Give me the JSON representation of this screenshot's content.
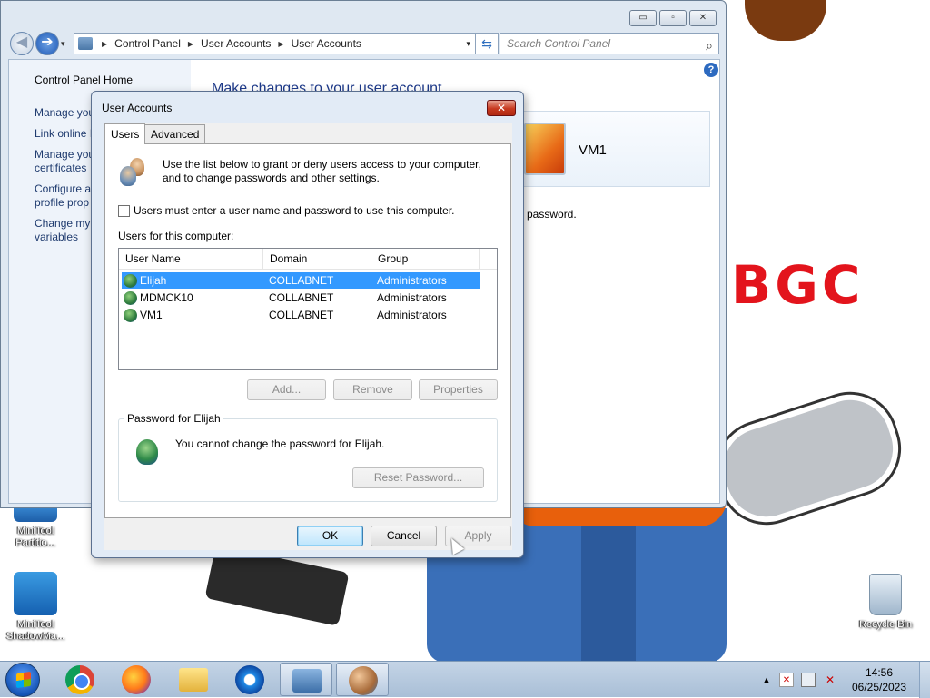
{
  "desktop": {
    "wallpaper_logo": "BGC",
    "icons": [
      {
        "label": "MiniTool Partitio..."
      },
      {
        "label": "MiniTool ShadowMa..."
      },
      {
        "label": "Recycle Bin"
      }
    ]
  },
  "control_panel": {
    "caption_buttons": {
      "minimize": "▭",
      "maximize": "▫",
      "close": "✕"
    },
    "nav": {
      "back": "◀",
      "forward": "➔",
      "dropdown": "▾"
    },
    "breadcrumb": [
      "Control Panel",
      "User Accounts",
      "User Accounts"
    ],
    "breadcrumb_arrow": "▶",
    "address_dropdown": "▾",
    "refresh_icon": "⇆",
    "search": {
      "placeholder": "Search Control Panel",
      "icon": "⌕"
    },
    "help_icon": "?",
    "sidebar": {
      "home": "Control Panel Home",
      "links": [
        "Manage you",
        "Link online I",
        "Manage you\ncertificates",
        "Configure a\nprofile prop",
        "Change my\nvariables"
      ]
    },
    "heading": "Make changes to your user account",
    "account_name": "VM1",
    "password_text": "password."
  },
  "dialog": {
    "title": "User Accounts",
    "close_label": "✕",
    "tabs": [
      "Users",
      "Advanced"
    ],
    "intro": "Use the list below to grant or deny users access to your computer, and to change passwords and other settings.",
    "checkbox_label": "Users must enter a user name and password to use this computer.",
    "checkbox_checked": false,
    "users_label": "Users for this computer:",
    "columns": [
      "User Name",
      "Domain",
      "Group"
    ],
    "rows": [
      {
        "name": "Elijah",
        "domain": "COLLABNET",
        "group": "Administrators",
        "selected": true
      },
      {
        "name": "MDMCK10",
        "domain": "COLLABNET",
        "group": "Administrators",
        "selected": false
      },
      {
        "name": "VM1",
        "domain": "COLLABNET",
        "group": "Administrators",
        "selected": false
      }
    ],
    "buttons": {
      "add": "Add...",
      "remove": "Remove",
      "properties": "Properties"
    },
    "password_group": {
      "legend": "Password for Elijah",
      "message": "You cannot change the password for Elijah.",
      "reset": "Reset Password..."
    },
    "footer": {
      "ok": "OK",
      "cancel": "Cancel",
      "apply": "Apply"
    }
  },
  "taskbar": {
    "items": [
      "chrome-icon",
      "firefox-icon",
      "explorer-icon",
      "ie-icon",
      "control-panel-icon",
      "user-accounts-icon"
    ],
    "tray": {
      "show_hidden": "▲",
      "flag": "✕",
      "volume": "✕"
    },
    "clock": {
      "time": "14:56",
      "date": "06/25/2023"
    }
  },
  "colors": {
    "selection": "#3399ff",
    "heading": "#1e3a8a",
    "close_button": "#c7391f",
    "wallpaper_logo": "#e3141c"
  }
}
